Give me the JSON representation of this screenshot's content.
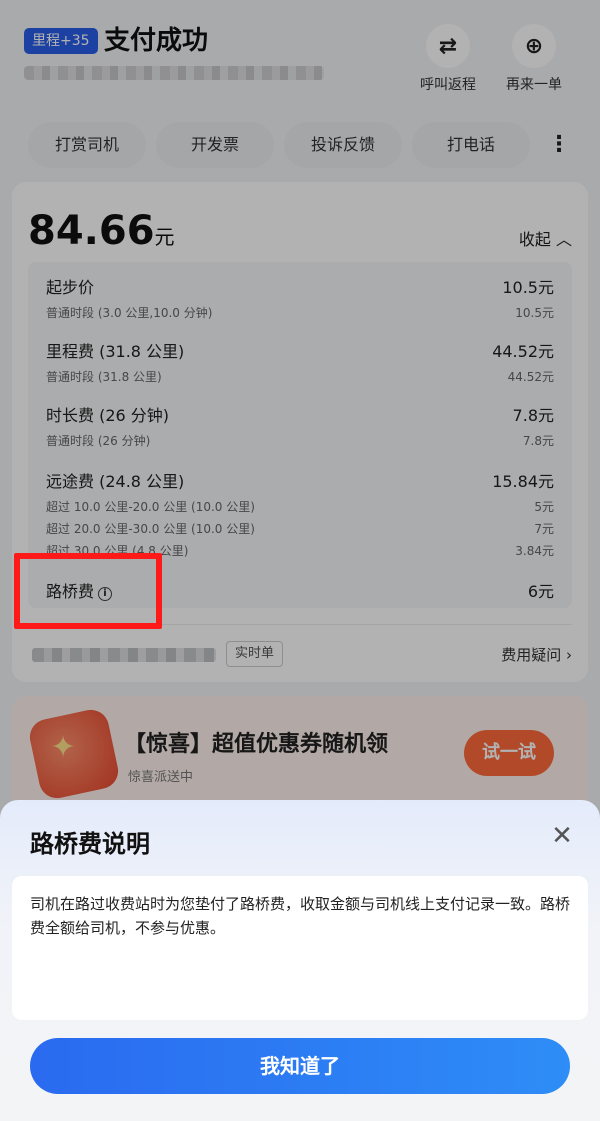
{
  "header": {
    "badge": "里程+35",
    "title": "支付成功",
    "actions": [
      {
        "label": "呼叫返程",
        "icon": "repeat-icon"
      },
      {
        "label": "再来一单",
        "icon": "plus-circle-icon"
      }
    ]
  },
  "chips": [
    "打赏司机",
    "开发票",
    "投诉反馈",
    "打电话"
  ],
  "fare": {
    "amount": "84.66",
    "unit": "元",
    "collapse_label": "收起",
    "items": [
      {
        "label": "起步价",
        "value": "10.5元",
        "subs": [
          {
            "label": "普通时段 (3.0 公里,10.0 分钟)",
            "value": "10.5元"
          }
        ]
      },
      {
        "label": "里程费 (31.8 公里)",
        "value": "44.52元",
        "subs": [
          {
            "label": "普通时段 (31.8 公里)",
            "value": "44.52元"
          }
        ]
      },
      {
        "label": "时长费 (26 分钟)",
        "value": "7.8元",
        "subs": [
          {
            "label": "普通时段 (26 分钟)",
            "value": "7.8元"
          }
        ]
      },
      {
        "label": "远途费 (24.8 公里)",
        "value": "15.84元",
        "subs": [
          {
            "label": "超过 10.0 公里-20.0 公里 (10.0 公里)",
            "value": "5元"
          },
          {
            "label": "超过 20.0 公里-30.0 公里 (10.0 公里)",
            "value": "7元"
          },
          {
            "label": "超过 30.0 公里 (4.8 公里)",
            "value": "3.84元"
          }
        ]
      },
      {
        "label": "路桥费",
        "value": "6元",
        "subs": []
      }
    ],
    "realtime_tag": "实时单",
    "fee_question": "费用疑问"
  },
  "promo": {
    "title": "【惊喜】超值优惠券随机领",
    "subtitle": "惊喜派送中",
    "button": "试一试"
  },
  "sheet": {
    "title": "路桥费说明",
    "body": "司机在路过收费站时为您垫付了路桥费，收取金额与司机线上支付记录一致。路桥费全额给司机，不参与优惠。",
    "button": "我知道了"
  },
  "colors": {
    "badge": "#2a5de8",
    "primary_button": "#2e7cf5",
    "try_button": "#ff6b3d",
    "highlight": "#ff1a1a"
  }
}
